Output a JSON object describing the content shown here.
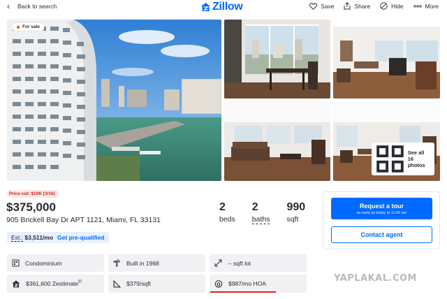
{
  "topbar": {
    "back_label": "Back to search",
    "brand": "Zillow",
    "actions": [
      {
        "icon": "heart-icon",
        "label": "Save"
      },
      {
        "icon": "share-icon",
        "label": "Share"
      },
      {
        "icon": "hide-icon",
        "label": "Hide"
      },
      {
        "icon": "more-icon",
        "label": "More"
      }
    ]
  },
  "gallery": {
    "badge": "For sale",
    "see_all": "See all 16 photos"
  },
  "listing": {
    "price_cut": "Price cut: $10K (3/16)",
    "price": "$375,000",
    "address": "905 Brickell Bay Dr APT 1121, Miami, FL 33131",
    "beds_num": "2",
    "beds_label": "beds",
    "baths_num": "2",
    "baths_label": "baths",
    "sqft_num": "990",
    "sqft_label": "sqft",
    "est_prefix": "Est.:",
    "est_value": "$3,511/mo",
    "prequal": "Get pre-qualified"
  },
  "cta": {
    "tour_label": "Request a tour",
    "tour_sub": "as early as today at 11:00 am",
    "agent_label": "Contact agent"
  },
  "facts": {
    "type": "Condominium",
    "built": "Built in 1968",
    "lot": "-- sqft lot",
    "zestimate": "$361,600 Zestimate",
    "zestimate_sup": "®",
    "price_sqft": "$379/sqft",
    "hoa": "$987/mo HOA"
  },
  "colors": {
    "brand_blue": "#006aff",
    "price_cut_red": "#c7221b",
    "hoa_underline": "#d8231f"
  },
  "watermark": "YAPLAKAL.COM"
}
